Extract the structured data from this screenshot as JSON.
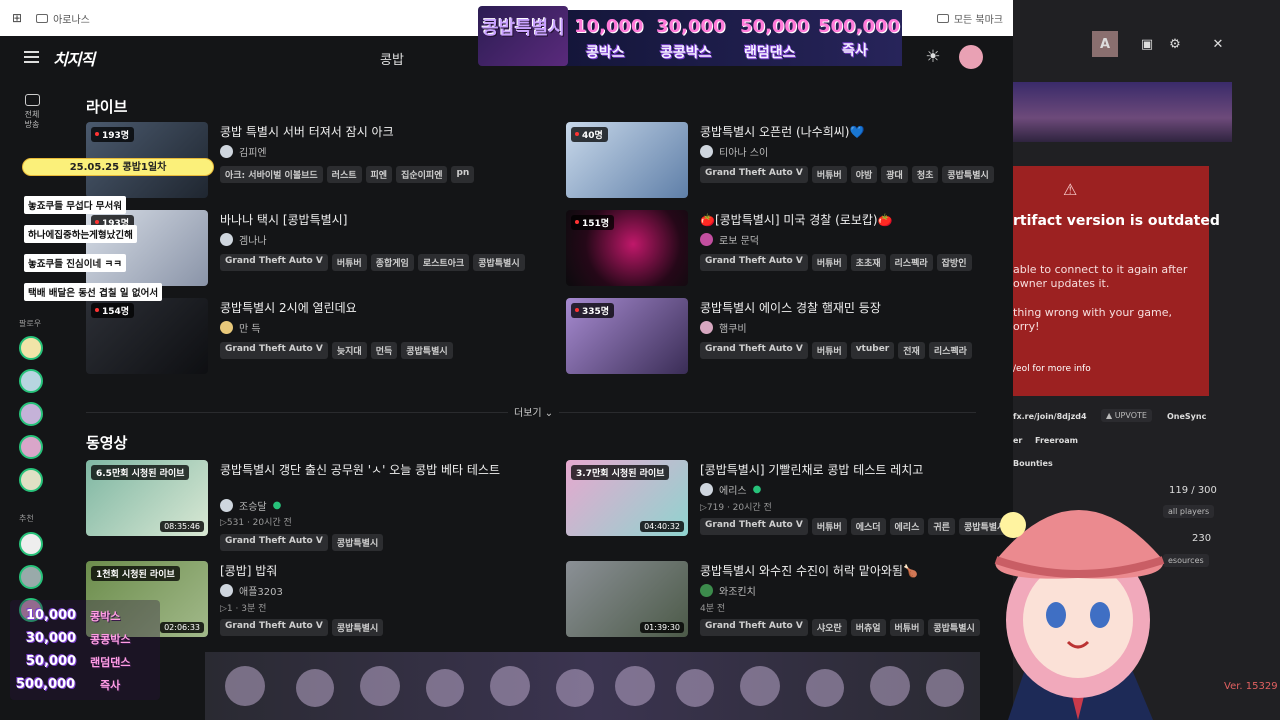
{
  "bookmarks": {
    "folder": "아로나스",
    "all_bookmarks": "모든 북마크"
  },
  "header": {
    "logo": "치지직",
    "search_value": "콩밥"
  },
  "sidebar": {
    "items": [
      {
        "label": "전체\n방송"
      }
    ],
    "follow_heading": "팔로우",
    "recommend_heading": "추천"
  },
  "live": {
    "title": "라이브",
    "cards": [
      {
        "viewers": "193명",
        "title": "콩밥 특별시 서버 터져서 잠시 아크",
        "channel": "김피엔",
        "tags": [
          "아크: 서바이벌 이볼브드",
          "러스트",
          "피엔",
          "집순이피엔",
          "pn"
        ]
      },
      {
        "viewers": "40명",
        "title": "콩밥특별시 오픈런 (나수희씨)💙",
        "channel": "티아나 스이",
        "tags": [
          "Grand Theft Auto V",
          "버튜버",
          "야밤",
          "광대",
          "청초",
          "콩밥특별시"
        ]
      },
      {
        "viewers": "193명",
        "title": "바나나 택시 [콩밥특별시]",
        "channel": "겜나나",
        "tags": [
          "Grand Theft Auto V",
          "버튜버",
          "종합게임",
          "로스트아크",
          "콩밥특별시"
        ]
      },
      {
        "viewers": "151명",
        "title": "🍅[콩밥특별시] 미국 경찰 (로보캅)🍅",
        "channel": "로보 문덕",
        "tags": [
          "Grand Theft Auto V",
          "버튜버",
          "초초재",
          "리스펙라",
          "잡방인"
        ]
      },
      {
        "viewers": "154명",
        "title": "콩밥특별시 2시에 열린데요",
        "channel": "만 득",
        "tags": [
          "Grand Theft Auto V",
          "늦지대",
          "먼득",
          "콩밥특별시"
        ]
      },
      {
        "viewers": "335명",
        "title": "콩밥특별시 에이스 경찰 햄재민 등장",
        "channel": "햄쿠비",
        "tags": [
          "Grand Theft Auto V",
          "버튜버",
          "vtuber",
          "전재",
          "리스펙라"
        ]
      }
    ],
    "more": "더보기"
  },
  "videos": {
    "title": "동영상",
    "cards": [
      {
        "badge": "6.5만회 시청된 라이브",
        "duration": "08:35:46",
        "title": "콩밥특별시 갱단 출신 공무원 'ㅅ' 오늘 콩밥 베타 테스트",
        "channel": "조승달",
        "meta": "▷531 · 20시간 전",
        "tags": [
          "Grand Theft Auto V",
          "콩밥특별시"
        ]
      },
      {
        "badge": "3.7만회 시청된 라이브",
        "duration": "04:40:32",
        "title": "[콩밥특별시] 기빨린채로 콩밥 테스트 레치고",
        "channel": "에리스",
        "meta": "▷719 · 20시간 전",
        "tags": [
          "Grand Theft Auto V",
          "버튜버",
          "에스더",
          "에리스",
          "귀른",
          "콩밥특별시"
        ]
      },
      {
        "badge": "1천회 시청된 라이브",
        "duration": "02:06:33",
        "title": "[콩밥] 밥줘",
        "channel": "애플3203",
        "meta": "▷1 · 3분 전",
        "tags": [
          "Grand Theft Auto V",
          "콩밥특별시"
        ]
      },
      {
        "badge": "",
        "duration": "01:39:30",
        "title": "콩밥특별시 와수진 수진이 허락 맡아와됨🍗",
        "channel": "와조킨치",
        "meta": "4분 전",
        "tags": [
          "Grand Theft Auto V",
          "샤오란",
          "버츄얼",
          "버튜버",
          "콩밥특별시"
        ]
      }
    ]
  },
  "overlay": {
    "banner_title": "콩밥특별시",
    "numbers": [
      "10,000",
      "30,000",
      "50,000",
      "500,000"
    ],
    "labels": [
      "콩박스",
      "콩콩박스",
      "랜덤댄스",
      "즉사"
    ],
    "date_pill": "25.05.25 콩밥1일차",
    "chats": [
      "놓죠쿠들 무섭다 무서워",
      "하나에집중하는게형났긴해",
      "놓죠쿠들 진심이네 ㅋㅋ",
      "택배 배달은 동선 겹칠 일 없어서"
    ]
  },
  "right_panel": {
    "avatar_letter": "A",
    "error_title": "rtifact version is outdated",
    "error_lines": [
      "able to connect to it again after",
      "owner updates it.",
      "thing wrong with your game,",
      "orry!"
    ],
    "error_link": "/eol for more info",
    "link_row": [
      "fx.re/join/8djzd4",
      "UPVOTE",
      "OneSync"
    ],
    "row2": [
      "er",
      "Freeroam"
    ],
    "bounties": "Bounties",
    "players": "119 / 300",
    "all_players": "all players",
    "count2": "230",
    "resources": "esources",
    "version": "Ver. 15329"
  }
}
